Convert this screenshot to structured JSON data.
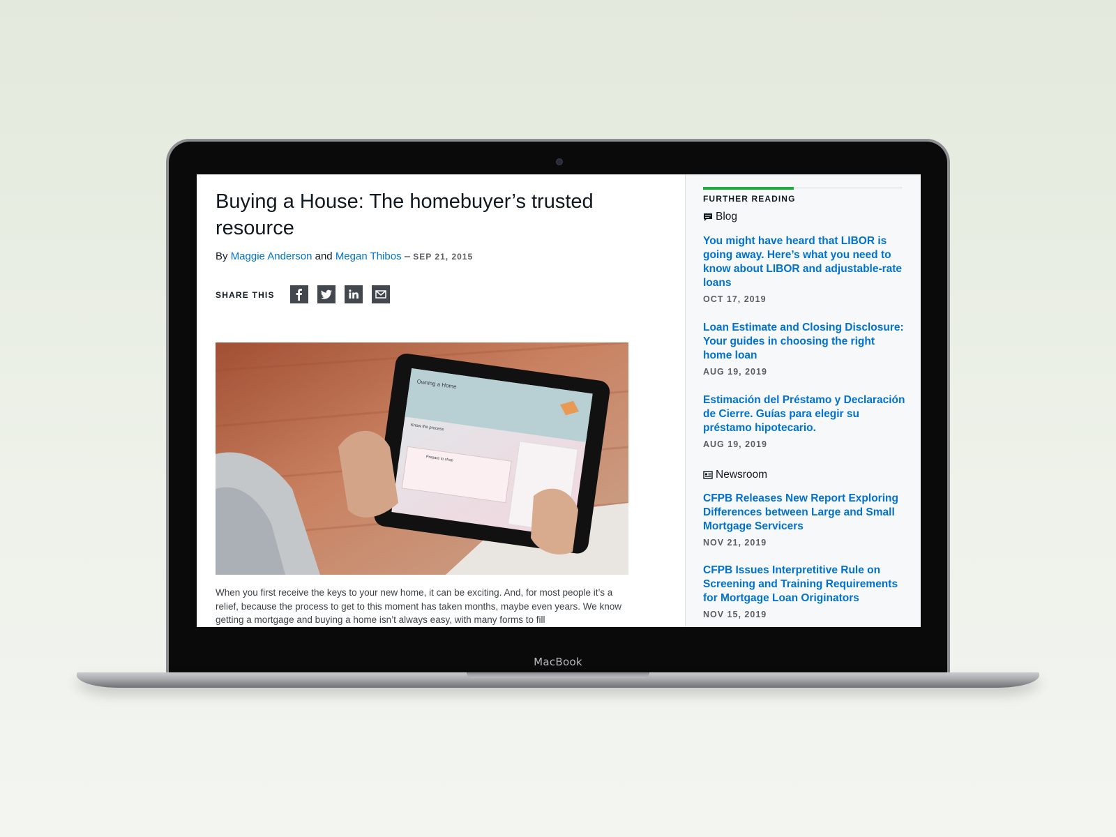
{
  "device": {
    "brand_label": "MacBook"
  },
  "article": {
    "title": "Buying a House: The homebuyer’s trusted resource",
    "byline": {
      "prefix": "By",
      "author1": "Maggie Anderson",
      "conjunction": "and",
      "author2": "Megan Thibos",
      "separator": "–",
      "date": "SEP 21, 2015"
    },
    "share": {
      "label": "SHARE THIS",
      "icons": [
        "facebook-icon",
        "twitter-icon",
        "linkedin-icon",
        "email-icon"
      ]
    },
    "hero_image": {
      "tablet_heading": "Owning a Home",
      "tablet_section": "Know the process",
      "tablet_card": "Prepare to shop"
    },
    "body": "When you first receive the keys to your new home, it can be exciting. And, for most people it’s a relief, because the process to get to this moment has taken months, maybe even years. We know getting a mortgage and buying a home isn’t always easy, with many forms to fill"
  },
  "sidebar": {
    "heading": "FURTHER READING",
    "accent_color": "#20aa3f",
    "sections": [
      {
        "label": "Blog",
        "icon": "chat-icon",
        "items": [
          {
            "title": "You might have heard that LIBOR is going away. Here’s what you need to know about LIBOR and adjustable-rate loans",
            "date": "OCT 17, 2019"
          },
          {
            "title": "Loan Estimate and Closing Disclosure: Your guides in choosing the right home loan",
            "date": "AUG 19, 2019"
          },
          {
            "title": "Estimación del Préstamo y Declaración de Cierre. Guías para elegir su préstamo hipotecario.",
            "date": "AUG 19, 2019"
          }
        ]
      },
      {
        "label": "Newsroom",
        "icon": "newspaper-icon",
        "items": [
          {
            "title": "CFPB Releases New Report Exploring Differences between Large and Small Mortgage Servicers",
            "date": "NOV 21, 2019"
          },
          {
            "title": "CFPB Issues Interpretitive Rule on Screening and Training Requirements for Mortgage Loan Originators",
            "date": "NOV 15, 2019"
          }
        ]
      }
    ]
  },
  "colors": {
    "link": "#0072ce",
    "text": "#101820",
    "icon_bg": "#43484e"
  }
}
